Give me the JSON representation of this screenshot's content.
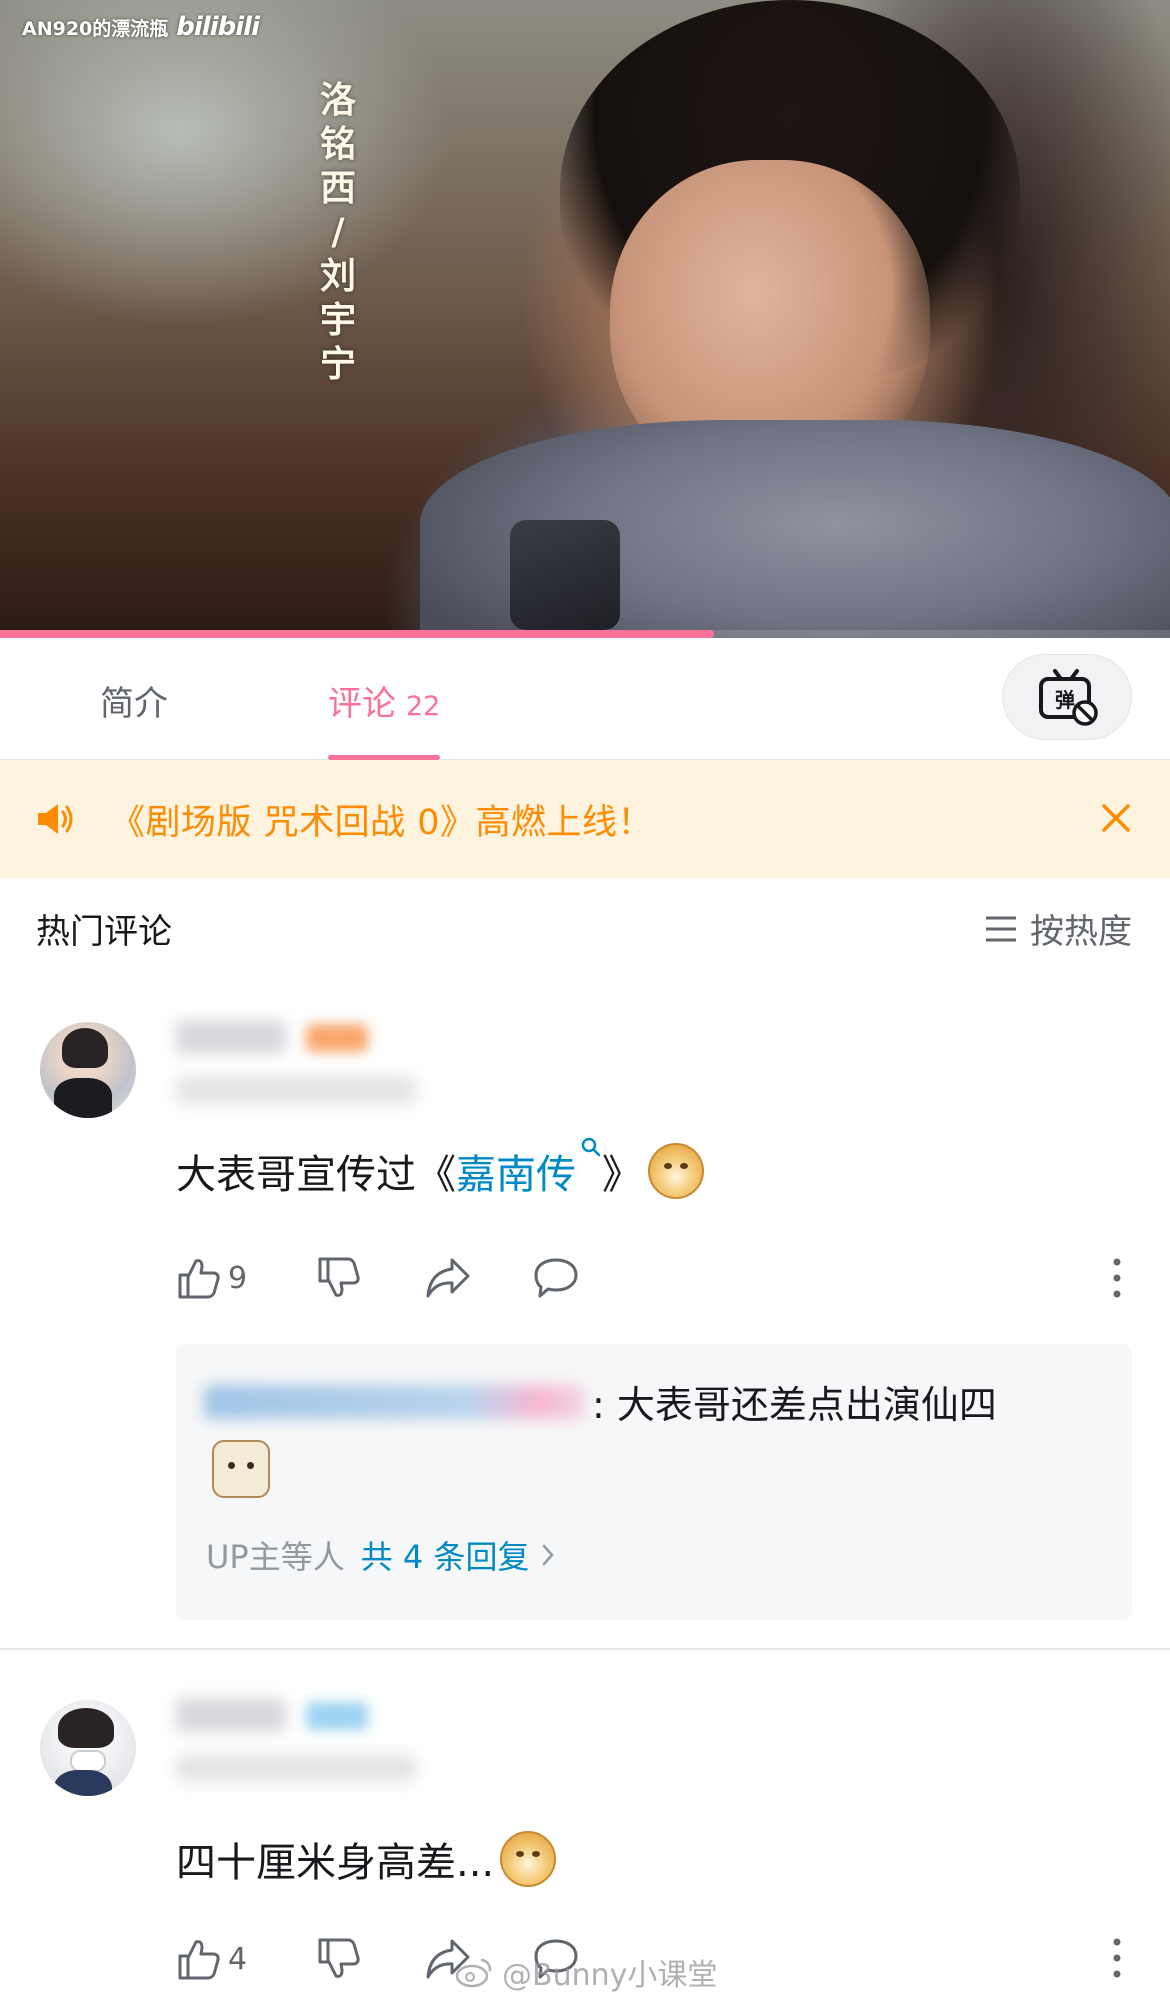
{
  "video": {
    "watermark_channel": "AN920的漂流瓶",
    "watermark_brand": "bilibili",
    "caption_chars": [
      "洛",
      "铭",
      "西",
      "/",
      "刘",
      "宇",
      "宁"
    ],
    "progress_fraction": 0.61
  },
  "tabs": {
    "intro_label": "简介",
    "comments_label": "评论",
    "comments_count": "22",
    "active_color": "#fb7299"
  },
  "banner": {
    "text": "《剧场版 咒术回战 0》高燃上线！",
    "text_color": "#ff8c00",
    "background": "#fef3de"
  },
  "sort_header": {
    "title": "热门评论",
    "sort_label": "按热度"
  },
  "comments": [
    {
      "text_before": "大表哥宣传过《",
      "link_text": "嘉南传",
      "text_after": "》",
      "emoji": "doge",
      "likes": "9",
      "reply": {
        "text": ": 大表哥还差点出演仙四",
        "emoji": "dog-face",
        "summary_prefix": "UP主等人",
        "summary_total": "共 4 条回复"
      }
    },
    {
      "text": "四十厘米身高差...",
      "emoji": "doge",
      "likes": "4"
    }
  ],
  "footer_watermark": "@Bunny小课堂",
  "colors": {
    "link": "#008ac5",
    "secondary_text": "#61666d",
    "divider": "#e3e5e7"
  }
}
